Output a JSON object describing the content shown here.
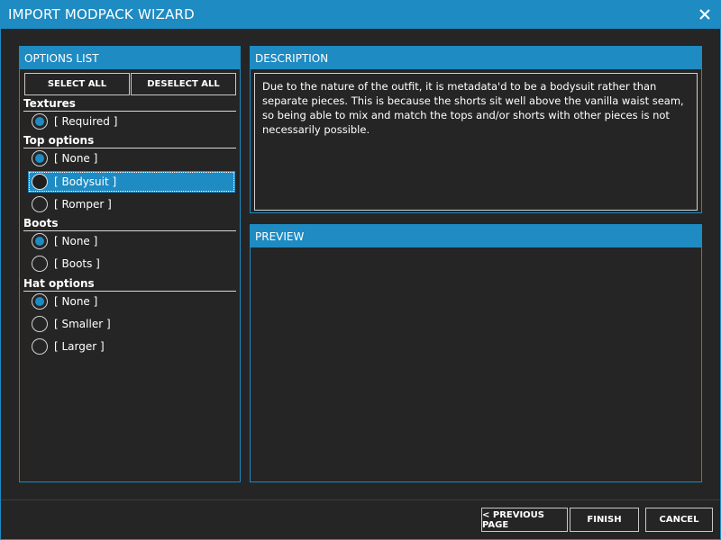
{
  "window": {
    "title": "IMPORT MODPACK WIZARD",
    "close_icon": "close-icon",
    "accent_color": "#1e8bc3",
    "background_color": "#252525"
  },
  "options_panel": {
    "header": "OPTIONS LIST",
    "select_all_label": "SELECT ALL",
    "deselect_all_label": "DESELECT ALL",
    "groups": [
      {
        "title": "Textures",
        "options": [
          {
            "label": "[ Required ]",
            "checked": true
          }
        ]
      },
      {
        "title": "Top options",
        "options": [
          {
            "label": "[ None ]",
            "checked": true
          },
          {
            "label": "[ Bodysuit ]",
            "checked": false,
            "highlighted": true
          },
          {
            "label": "[ Romper ]",
            "checked": false
          }
        ]
      },
      {
        "title": "Boots",
        "options": [
          {
            "label": "[ None ]",
            "checked": true
          },
          {
            "label": "[ Boots ]",
            "checked": false
          }
        ]
      },
      {
        "title": "Hat options",
        "options": [
          {
            "label": "[ None ]",
            "checked": true
          },
          {
            "label": "[ Smaller ]",
            "checked": false
          },
          {
            "label": "[ Larger ]",
            "checked": false
          }
        ]
      }
    ]
  },
  "description_panel": {
    "header": "DESCRIPTION",
    "text": "Due to the nature of the outfit, it is metadata'd to be a bodysuit rather than separate pieces. This is because the shorts sit well above the vanilla waist seam, so being able to mix and match the tops and/or shorts with other pieces is not necessarily possible."
  },
  "preview_panel": {
    "header": "PREVIEW"
  },
  "footer": {
    "previous_label": "< PREVIOUS PAGE",
    "finish_label": "FINISH",
    "cancel_label": "CANCEL"
  }
}
